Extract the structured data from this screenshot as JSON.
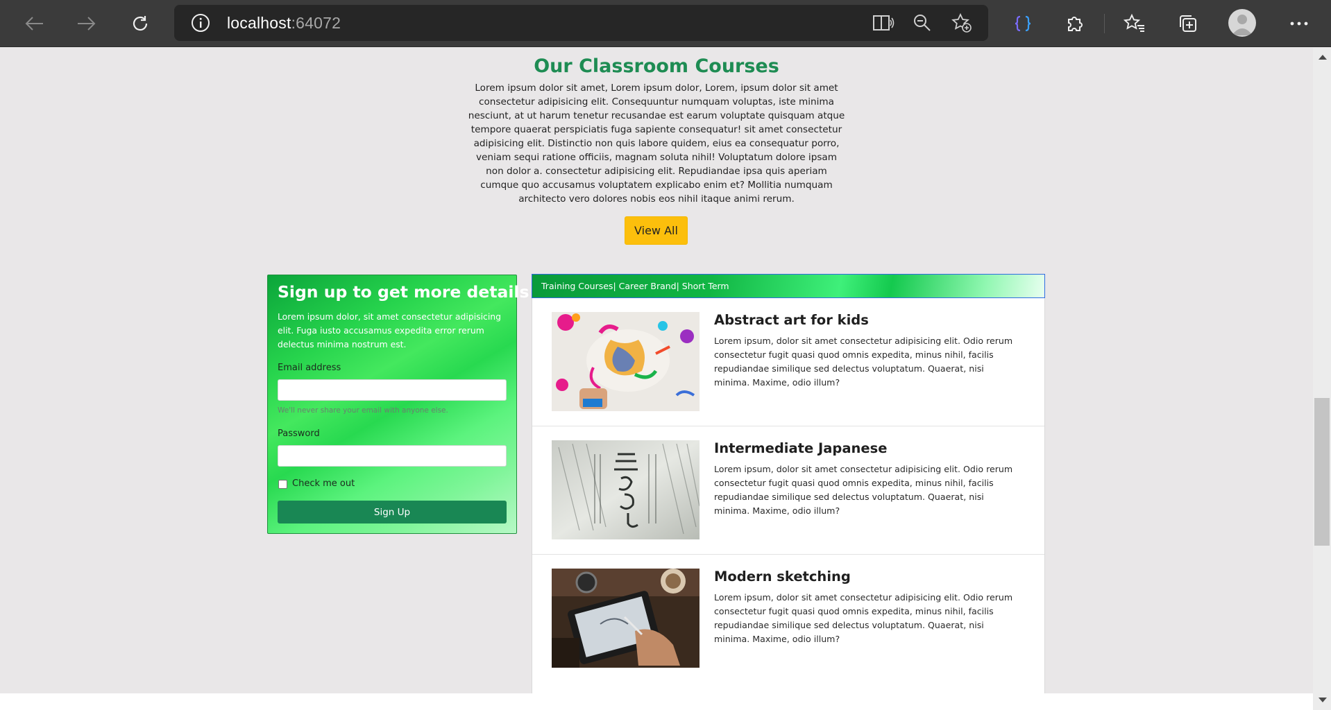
{
  "browser": {
    "url_host": "localhost",
    "url_port": ":64072",
    "icons": {
      "back": "back-arrow-icon",
      "forward": "forward-arrow-icon",
      "refresh": "refresh-icon",
      "site_info": "info-icon",
      "read_aloud": "read-aloud-icon",
      "zoom": "zoom-out-icon",
      "add_favorite": "add-favorite-icon",
      "devtools_ext": "braces-extension-icon",
      "extensions": "puzzle-icon",
      "favorites": "favorites-icon",
      "collections": "collections-icon",
      "profile": "profile-avatar",
      "menu": "more-menu-icon"
    }
  },
  "intro": {
    "title": "Our Classroom Courses",
    "text": "Lorem ipsum dolor sit amet, Lorem ipsum dolor, Lorem, ipsum dolor sit amet consectetur adipisicing elit. Consequuntur numquam voluptas, iste minima nesciunt, at ut harum tenetur recusandae est earum voluptate quisquam atque tempore quaerat perspiciatis fuga sapiente consequatur! sit amet consectetur adipisicing elit. Distinctio non quis labore quidem, eius ea consequatur porro, veniam sequi ratione officiis, magnam soluta nihil! Voluptatum dolore ipsam non dolor a. consectetur adipisicing elit. Repudiandae ipsa quis aperiam cumque quo accusamus voluptatem explicabo enim et? Mollitia numquam architecto vero dolores nobis eos nihil itaque animi rerum.",
    "button": "View All"
  },
  "signup": {
    "title": "Sign up to get more details",
    "description": "Lorem ipsum dolor, sit amet consectetur adipisicing elit. Fuga iusto accusamus expedita error rerum delectus minima nostrum est.",
    "email_label": "Email address",
    "email_help": "We'll never share your email with anyone else.",
    "password_label": "Password",
    "check_label": "Check me out",
    "button": "Sign Up"
  },
  "courses": {
    "header": "Training Courses| Career Brand| Short Term",
    "items": [
      {
        "title": "Abstract art for kids",
        "description": "Lorem ipsum, dolor sit amet consectetur adipisicing elit. Odio rerum consectetur fugit quasi quod omnis expedita, minus nihil, facilis repudiandae similique sed delectus voluptatum. Quaerat, nisi minima. Maxime, odio illum?"
      },
      {
        "title": "Intermediate Japanese",
        "description": "Lorem ipsum, dolor sit amet consectetur adipisicing elit. Odio rerum consectetur fugit quasi quod omnis expedita, minus nihil, facilis repudiandae similique sed delectus voluptatum. Quaerat, nisi minima. Maxime, odio illum?"
      },
      {
        "title": "Modern sketching",
        "description": "Lorem ipsum, dolor sit amet consectetur adipisicing elit. Odio rerum consectetur fugit quasi quod omnis expedita, minus nihil, facilis repudiandae similique sed delectus voluptatum. Quaerat, nisi minima. Maxime, odio illum?"
      }
    ]
  },
  "colors": {
    "heading_green": "#1e8c53",
    "button_yellow": "#fcbf0c",
    "signup_button": "#198754",
    "page_background": "#e9e7e8"
  }
}
